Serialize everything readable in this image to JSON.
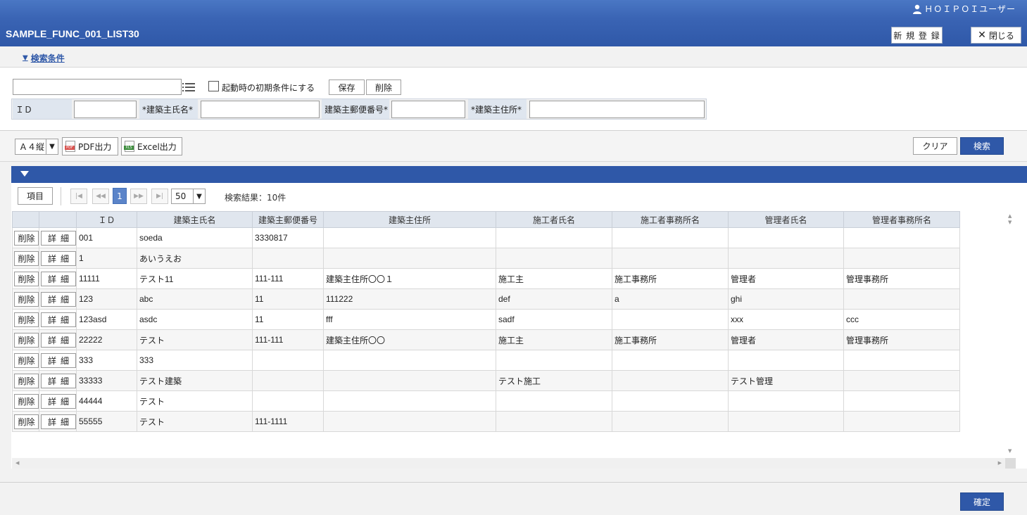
{
  "header": {
    "user_name": "ＨＯＩＰＯＩユーザー",
    "app_title": "SAMPLE_FUNC_001_LIST30",
    "new_button": "新 規 登 録",
    "close_button": "閉じる"
  },
  "search_condition": {
    "toggle_label": "検索条件",
    "preset_value": "",
    "default_checkbox_label": "起動時の初期条件にする",
    "save_button": "保存",
    "delete_button": "削除",
    "fields": [
      {
        "label": "ＩＤ",
        "value": ""
      },
      {
        "label": "*建築主氏名*",
        "value": ""
      },
      {
        "label": "建築主郵便番号*",
        "value": ""
      },
      {
        "label": "*建築主住所*",
        "value": ""
      }
    ]
  },
  "toolbar": {
    "paper_size": "Ａ４縦",
    "pdf_button": "PDF出力",
    "excel_button": "Excel出力",
    "clear_button": "クリア",
    "search_button": "検索"
  },
  "results": {
    "items_button": "項目",
    "current_page": "1",
    "page_size": "50",
    "count_text": "検索結果：10件",
    "row_delete_label": "削除",
    "row_detail_label": "詳細"
  },
  "table": {
    "columns": [
      "",
      "",
      "ＩＤ",
      "建築主氏名",
      "建築主郵便番号",
      "建築主住所",
      "施工者氏名",
      "施工者事務所名",
      "管理者氏名",
      "管理者事務所名"
    ],
    "rows": [
      [
        "001",
        "soeda",
        "3330817",
        "",
        "",
        "",
        "",
        ""
      ],
      [
        "1",
        "あいうえお",
        "",
        "",
        "",
        "",
        "",
        ""
      ],
      [
        "11111",
        "テスト11",
        "111-111",
        "建築主住所〇〇１",
        "施工主",
        "施工事務所",
        "管理者",
        "管理事務所"
      ],
      [
        "123",
        "abc",
        "11",
        "111222",
        "def",
        "a",
        "ghi",
        ""
      ],
      [
        "123asd",
        "asdc",
        "11",
        "fff",
        "sadf",
        "",
        "xxx",
        "ccc"
      ],
      [
        "22222",
        "テスト",
        "111-111",
        "建築主住所〇〇",
        "施工主",
        "施工事務所",
        "管理者",
        "管理事務所"
      ],
      [
        "333",
        "333",
        "",
        "",
        "",
        "",
        "",
        ""
      ],
      [
        "33333",
        "テスト建築",
        "",
        "",
        "テスト施工",
        "",
        "テスト管理",
        ""
      ],
      [
        "44444",
        "テスト",
        "",
        "",
        "",
        "",
        "",
        ""
      ],
      [
        "55555",
        "テスト",
        "111-1111",
        "",
        "",
        "",
        "",
        ""
      ]
    ]
  },
  "footer": {
    "confirm_button": "確定"
  },
  "colors": {
    "header_blue": "#2f58a8",
    "primary_button": "#2f58a8",
    "table_header_bg": "#e0e6ee"
  }
}
